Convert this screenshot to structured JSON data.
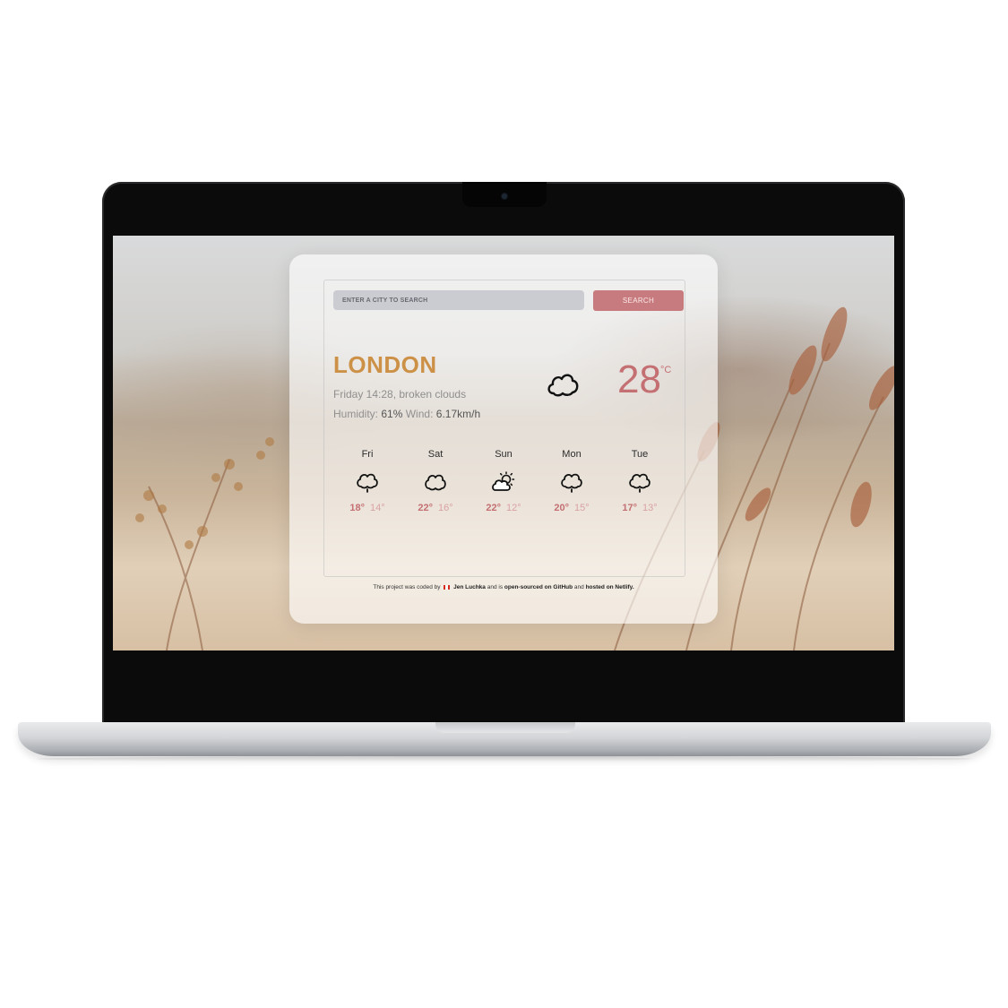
{
  "search": {
    "placeholder": "ENTER A CITY TO SEARCH",
    "button_label": "SEARCH"
  },
  "current": {
    "city": "LONDON",
    "description": "Friday 14:28, broken clouds",
    "humidity_label": "Humidity:",
    "humidity_value": "61%",
    "wind_label": "Wind:",
    "wind_value": "6.17km/h",
    "temperature": "28",
    "unit": "°C",
    "icon": "cloud-icon"
  },
  "forecast": [
    {
      "day": "Fri",
      "max": "18°",
      "min": "14°",
      "icon": "cloud-rain-icon"
    },
    {
      "day": "Sat",
      "max": "22°",
      "min": "16°",
      "icon": "cloud-icon"
    },
    {
      "day": "Sun",
      "max": "22°",
      "min": "12°",
      "icon": "sun-cloud-icon"
    },
    {
      "day": "Mon",
      "max": "20°",
      "min": "15°",
      "icon": "cloud-rain-icon"
    },
    {
      "day": "Tue",
      "max": "17°",
      "min": "13°",
      "icon": "cloud-rain-icon"
    }
  ],
  "footer": {
    "prefix": "This project was coded by",
    "author": "Jen Luchka",
    "middle1": "and is",
    "open_source": "open-sourced on GitHub",
    "middle2": "and",
    "hosted": "hosted on Netlify."
  },
  "colors": {
    "accent": "#c46f72",
    "city": "#cc9147",
    "button": "#c87b7e"
  }
}
